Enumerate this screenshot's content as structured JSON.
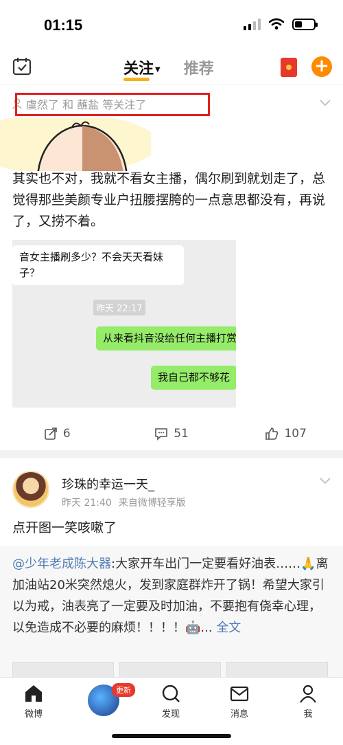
{
  "status_bar": {
    "time": "01:15"
  },
  "nav": {
    "tabs": [
      {
        "label": "关注",
        "active": true
      },
      {
        "label": "推荐",
        "active": false
      }
    ],
    "accent_color": "#f2b31a",
    "plus_color": "#ff8a00",
    "plus_label": "+"
  },
  "post1": {
    "follow_line": "虞然了 和 蘸盐 等关注了",
    "text": "其实也不对，我就不看女主播，偶尔刷到就划走了，总觉得那些美颜专业户扭腰摆胯的一点意思都没有，再说了，又捞不着。",
    "chat": {
      "left_message": "音女主播刷多少？不会天天看妹子？",
      "timestamp": "昨天 22:17",
      "right_message_1": "从来看抖音没给任何主播打赏",
      "right_message_2": "我自己都不够花"
    },
    "actions": {
      "share_count": "6",
      "comment_count": "51",
      "like_count": "107"
    }
  },
  "post2": {
    "author": "珍珠的幸运一天_",
    "time": "昨天 21:40",
    "source": "来自微博轻享版",
    "text": "点开图一笑咳嗽了",
    "repost": {
      "mention": "@少年老成陈大器",
      "text": ":大家开车出门一定要看好油表……🙏离加油站20米突然熄火，发到家庭群炸开了锅！希望大家引以为戒，油表亮了一定要及时加油，不要抱有侥幸心理，以免造成不必要的麻烦！！！！🤖...",
      "full_text_link": "全文"
    }
  },
  "tab_bar": {
    "home": "微博",
    "update_badge": "更新",
    "discover": "发现",
    "messages": "消息",
    "me": "我"
  }
}
